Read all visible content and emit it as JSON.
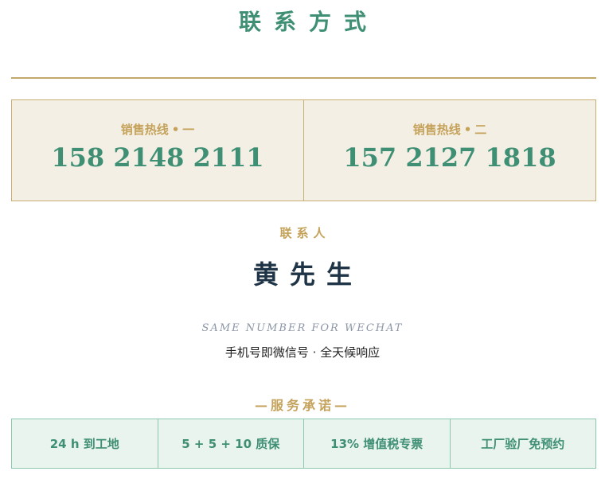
{
  "title": "联系方式",
  "hotlines": [
    {
      "label": "销售热线",
      "dot": "•",
      "index": "一",
      "number": "158 2148 2111"
    },
    {
      "label": "销售热线",
      "dot": "•",
      "index": "二",
      "number": "157 2127 1818"
    }
  ],
  "contact": {
    "label": "联系人",
    "name": "黄先生"
  },
  "wechat": {
    "english": "SAME NUMBER FOR WECHAT",
    "chinese": "手机号即微信号 · 全天候响应"
  },
  "promise": {
    "title": "—服务承诺—",
    "items": [
      "24 h 到工地",
      "5 + 5 + 10 质保",
      "13% 增值税专票",
      "工厂验厂免预约"
    ]
  },
  "colors": {
    "green": "#3f8f74",
    "gold": "#c4a25a",
    "navy": "#1f3446",
    "panel": "#f4efe4"
  }
}
